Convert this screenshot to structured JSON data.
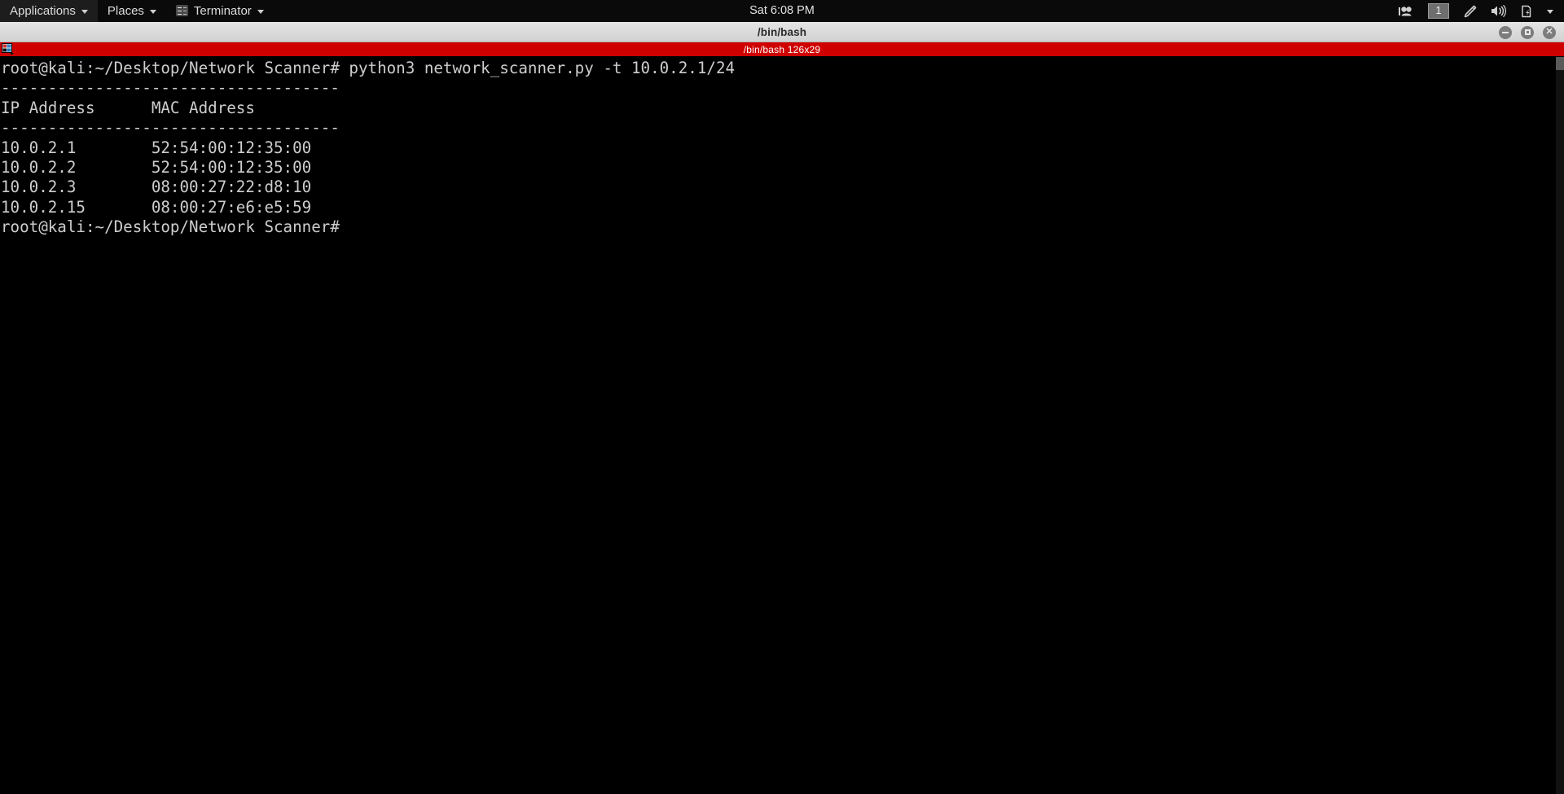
{
  "panel": {
    "menus": [
      {
        "label": "Applications",
        "name": "applications-menu"
      },
      {
        "label": "Places",
        "name": "places-menu"
      }
    ],
    "app_menu": {
      "label": "Terminator",
      "icon": "terminal-icon"
    },
    "clock": "Sat  6:08 PM",
    "tray": {
      "media_icon": "video-camera-icon",
      "workspace": "1",
      "pen_icon": "pen-icon",
      "volume_icon": "volume-icon",
      "battery_icon": "battery-icon",
      "chevron_icon": "chevron-down-icon"
    }
  },
  "window": {
    "title": "/bin/bash",
    "controls": {
      "minimize": "minimize-button",
      "maximize": "maximize-button",
      "close": "close-button"
    }
  },
  "tab": {
    "label": "/bin/bash 126x29",
    "icon": "layout-grid-icon",
    "accent_color": "#cf0000"
  },
  "terminal": {
    "foreground": "#cdcdcd",
    "background": "#000000",
    "prompt": "root@kali:~/Desktop/Network Scanner#",
    "command": "python3 network_scanner.py -t 10.0.2.1/24",
    "separator": "------------------------------------",
    "columns": [
      "IP Address",
      "MAC Address"
    ],
    "header_line": "IP Address      MAC Address",
    "rows": [
      {
        "ip": "10.0.2.1",
        "mac": "52:54:00:12:35:00"
      },
      {
        "ip": "10.0.2.2",
        "mac": "52:54:00:12:35:00"
      },
      {
        "ip": "10.0.2.3",
        "mac": "08:00:27:22:d8:10"
      },
      {
        "ip": "10.0.2.15",
        "mac": "08:00:27:e6:e5:59"
      }
    ],
    "lines": [
      "root@kali:~/Desktop/Network Scanner# python3 network_scanner.py -t 10.0.2.1/24",
      "------------------------------------",
      "IP Address      MAC Address",
      "------------------------------------",
      "10.0.2.1        52:54:00:12:35:00",
      "10.0.2.2        52:54:00:12:35:00",
      "10.0.2.3        08:00:27:22:d8:10",
      "10.0.2.15       08:00:27:e6:e5:59",
      "root@kali:~/Desktop/Network Scanner#"
    ]
  }
}
